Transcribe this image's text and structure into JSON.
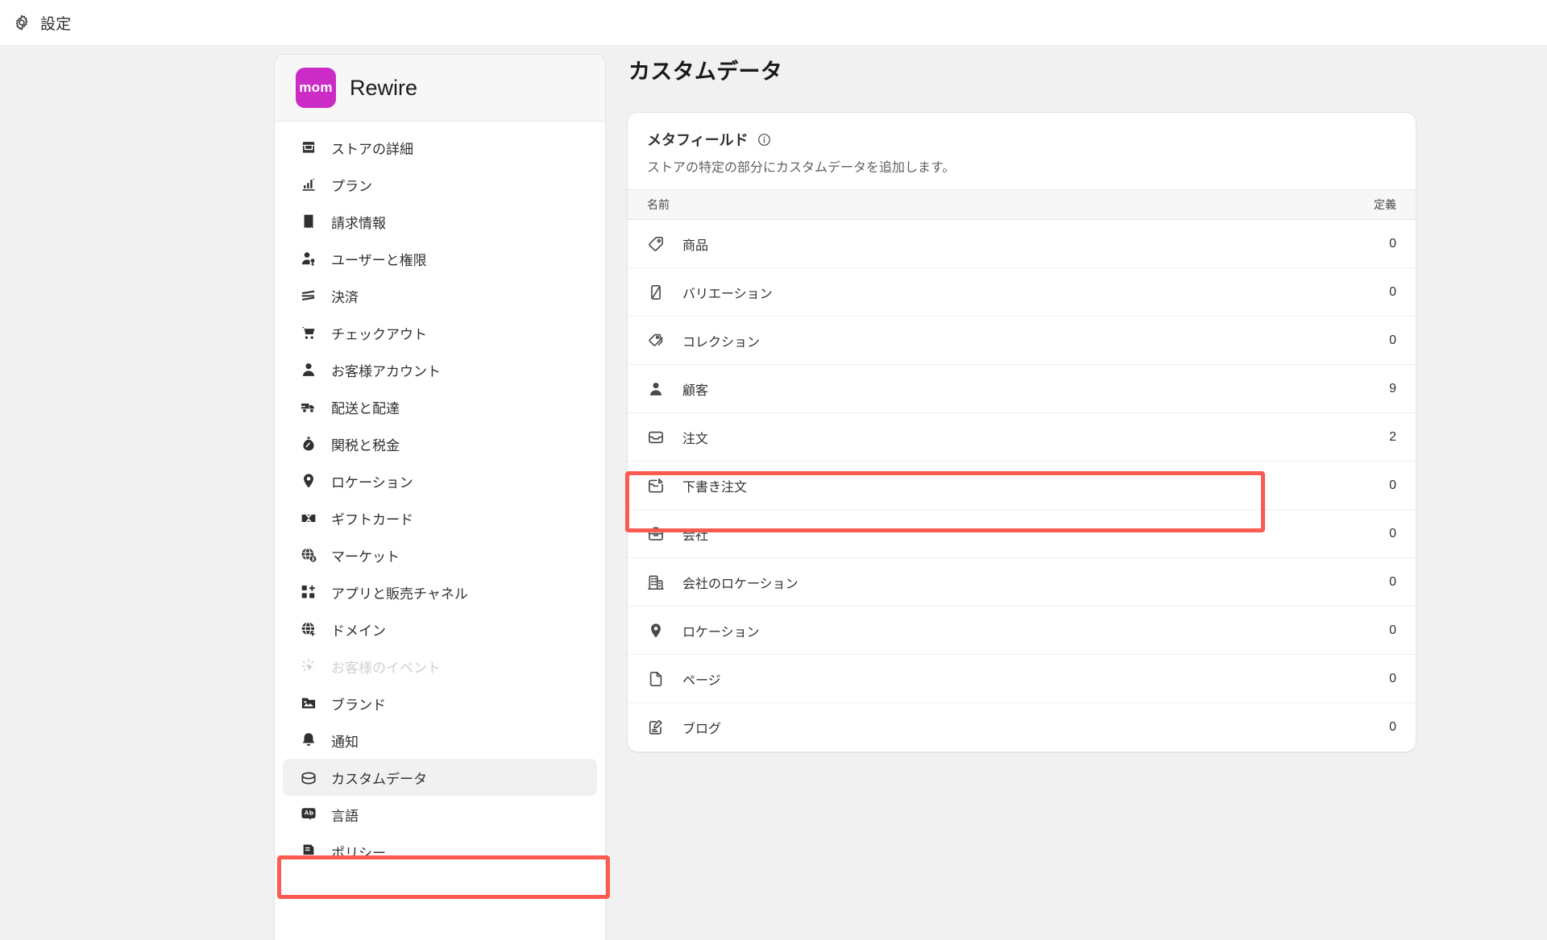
{
  "topbar": {
    "title": "設定",
    "gear_icon": "gear-icon"
  },
  "colors": {
    "accent_logo": "#cc2cc6",
    "highlight": "#fb5b50",
    "text_primary": "#303030",
    "text_secondary": "#616161",
    "page_bg": "#f1f1f1",
    "card_bg": "#ffffff"
  },
  "sidebar": {
    "store": {
      "logo_text": "mom",
      "name": "Rewire"
    },
    "items": [
      {
        "label": "ストアの詳細",
        "icon": "store-icon",
        "state": "default"
      },
      {
        "label": "プラン",
        "icon": "chart-plan-icon",
        "state": "default"
      },
      {
        "label": "請求情報",
        "icon": "receipt-icon",
        "state": "default"
      },
      {
        "label": "ユーザーと権限",
        "icon": "user-key-icon",
        "state": "default"
      },
      {
        "label": "決済",
        "icon": "payment-icon",
        "state": "default"
      },
      {
        "label": "チェックアウト",
        "icon": "cart-icon",
        "state": "default"
      },
      {
        "label": "お客様アカウント",
        "icon": "person-icon",
        "state": "default"
      },
      {
        "label": "配送と配達",
        "icon": "truck-icon",
        "state": "default"
      },
      {
        "label": "関税と税金",
        "icon": "money-bag-icon",
        "state": "default"
      },
      {
        "label": "ロケーション",
        "icon": "pin-icon",
        "state": "default"
      },
      {
        "label": "ギフトカード",
        "icon": "gift-card-icon",
        "state": "default"
      },
      {
        "label": "マーケット",
        "icon": "globe-dollar-icon",
        "state": "default"
      },
      {
        "label": "アプリと販売チャネル",
        "icon": "apps-icon",
        "state": "default"
      },
      {
        "label": "ドメイン",
        "icon": "globe-icon",
        "state": "default"
      },
      {
        "label": "お客様のイベント",
        "icon": "cursor-icon",
        "state": "disabled"
      },
      {
        "label": "ブランド",
        "icon": "brand-image-icon",
        "state": "default"
      },
      {
        "label": "通知",
        "icon": "bell-icon",
        "state": "default"
      },
      {
        "label": "カスタムデータ",
        "icon": "custom-data-icon",
        "state": "selected"
      },
      {
        "label": "言語",
        "icon": "language-icon",
        "state": "default"
      },
      {
        "label": "ポリシー",
        "icon": "policy-icon",
        "state": "default"
      }
    ]
  },
  "main": {
    "page_title": "カスタムデータ",
    "card": {
      "title": "メタフィールド",
      "info_icon": "info-icon",
      "subtitle": "ストアの特定の部分にカスタムデータを追加します。",
      "columns": {
        "name": "名前",
        "definitions": "定義"
      },
      "rows": [
        {
          "label": "商品",
          "icon": "tag-icon",
          "count": "0",
          "highlighted": false
        },
        {
          "label": "バリエーション",
          "icon": "variant-icon",
          "count": "0",
          "highlighted": false
        },
        {
          "label": "コレクション",
          "icon": "collection-icon",
          "count": "0",
          "highlighted": false
        },
        {
          "label": "顧客",
          "icon": "person-icon",
          "count": "9",
          "highlighted": true
        },
        {
          "label": "注文",
          "icon": "order-icon",
          "count": "2",
          "highlighted": false
        },
        {
          "label": "下書き注文",
          "icon": "draft-order-icon",
          "count": "0",
          "highlighted": false
        },
        {
          "label": "会社",
          "icon": "briefcase-icon",
          "count": "0",
          "highlighted": false
        },
        {
          "label": "会社のロケーション",
          "icon": "building-icon",
          "count": "0",
          "highlighted": false
        },
        {
          "label": "ロケーション",
          "icon": "pin-icon",
          "count": "0",
          "highlighted": false
        },
        {
          "label": "ページ",
          "icon": "page-icon",
          "count": "0",
          "highlighted": false
        },
        {
          "label": "ブログ",
          "icon": "blog-icon",
          "count": "0",
          "highlighted": false
        }
      ]
    }
  }
}
